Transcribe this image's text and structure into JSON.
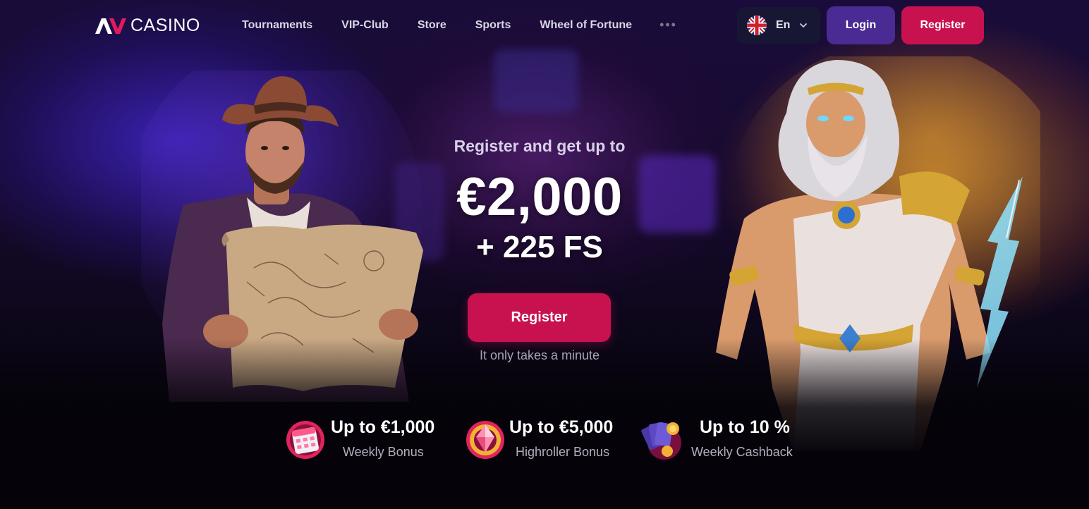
{
  "brand": {
    "logo_text": "CASINO"
  },
  "nav": {
    "items": [
      "Tournaments",
      "VIP-Club",
      "Store",
      "Sports",
      "Wheel of Fortune"
    ],
    "more_icon": "more-dots-icon"
  },
  "header": {
    "language": {
      "label": "En",
      "flag_icon": "uk-flag-icon"
    },
    "login_label": "Login",
    "register_label": "Register"
  },
  "promo": {
    "subtitle": "Register and get up to",
    "amount": "€2,000",
    "free_spins": "+ 225 FS",
    "register_label": "Register",
    "note": "It only takes a minute"
  },
  "bonuses": [
    {
      "title": "Up to €1,000",
      "label": "Weekly Bonus",
      "icon": "calendar-icon"
    },
    {
      "title": "Up to €5,000",
      "label": "Highroller Bonus",
      "icon": "diamond-icon"
    },
    {
      "title": "Up to 10 %",
      "label": "Weekly Cashback",
      "icon": "cards-coin-icon"
    }
  ],
  "colors": {
    "accent_register": "#c8124f",
    "login_button": "#4a2a93",
    "language_selector": "#171733",
    "background": "#050309"
  }
}
